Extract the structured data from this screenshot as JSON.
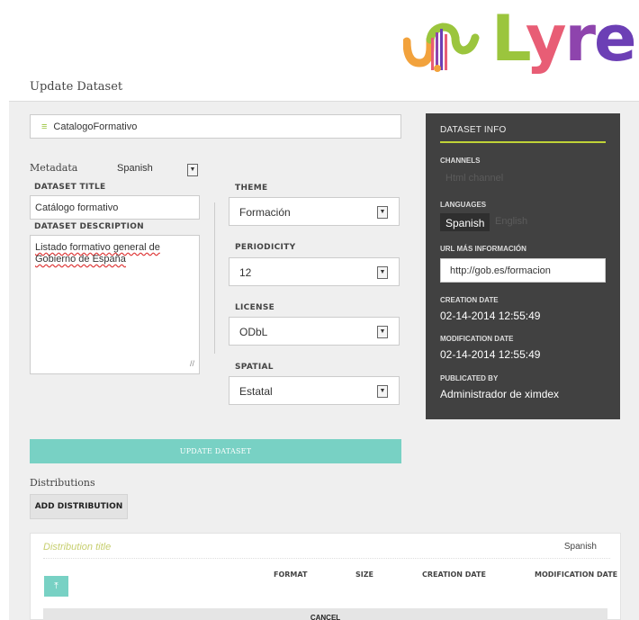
{
  "brand": {
    "name": "Lyre"
  },
  "page": {
    "title": "Update Dataset"
  },
  "dataset": {
    "name_value": "CatalogoFormativo",
    "metadata_label": "Metadata",
    "metadata_language": "Spanish",
    "title_label": "DATASET TITLE",
    "title_value": "Catálogo formativo",
    "description_label": "DATASET DESCRIPTION",
    "description_value": "Listado formativo general de Gobierno de España"
  },
  "selects": {
    "theme": {
      "label": "THEME",
      "value": "Formación"
    },
    "periodicity": {
      "label": "PERIODICITY",
      "value": "12"
    },
    "license": {
      "label": "LICENSE",
      "value": "ODbL"
    },
    "spatial": {
      "label": "SPATIAL",
      "value": "Estatal"
    }
  },
  "info": {
    "heading": "DATASET INFO",
    "channels_label": "CHANNELS",
    "channel_value": "Html channel",
    "languages_label": "LANGUAGES",
    "languages": [
      "Spanish",
      "English"
    ],
    "url_label": "URL MÁS INFORMACIÓN",
    "url_value": "http://gob.es/formacion",
    "creation_label": "CREATION DATE",
    "creation_value": "02-14-2014 12:55:49",
    "modification_label": "MODIFICATION DATE",
    "modification_value": "02-14-2014 12:55:49",
    "publicated_label": "PUBLICATED BY",
    "publicated_value": "Administrador de ximdex"
  },
  "actions": {
    "update_label": "UPDATE DATASET"
  },
  "distributions": {
    "heading": "Distributions",
    "add_label": "ADD DISTRIBUTION",
    "title_placeholder": "Distribution title",
    "language": "Spanish",
    "columns": [
      "FORMAT",
      "SIZE",
      "CREATION DATE",
      "MODIFICATION DATE"
    ],
    "cancel_label": "CANCEL"
  },
  "colors": {
    "accent_teal": "#78d1c4",
    "accent_lime": "#c0d337",
    "info_bg": "#414141"
  },
  "icons": {
    "handle": "reorder-icon",
    "caret": "chevron-down-icon",
    "upload": "upload-icon",
    "resize": "resize-grip-icon"
  }
}
